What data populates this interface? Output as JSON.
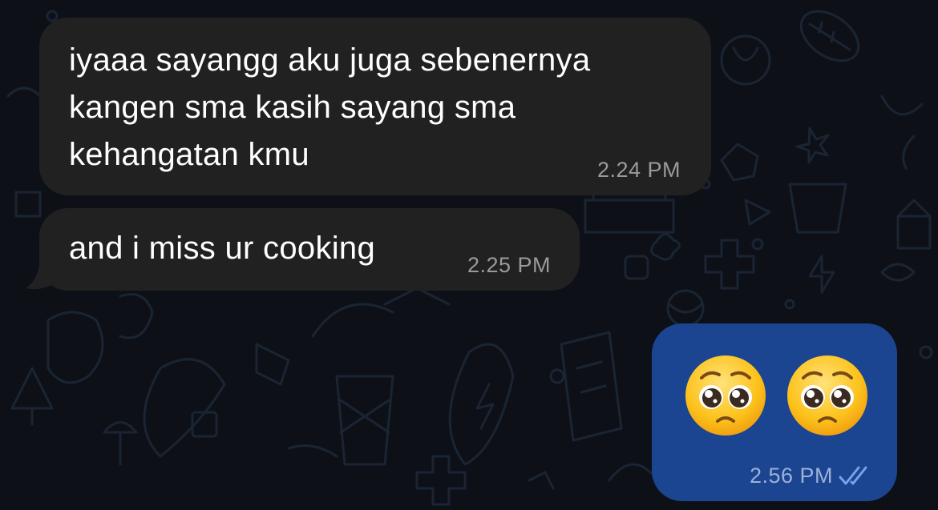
{
  "messages": [
    {
      "direction": "incoming",
      "lines": [
        "iyaaa sayangg aku juga sebenernya",
        "kangen sma kasih sayang sma",
        "kehangatan kmu"
      ],
      "time": "2.24 PM"
    },
    {
      "direction": "incoming",
      "text": "and i miss ur cooking",
      "time": "2.25 PM"
    },
    {
      "direction": "outgoing",
      "emojis": [
        "pleading-face",
        "pleading-face"
      ],
      "time": "2.56 PM",
      "status": "read"
    }
  ],
  "colors": {
    "background": "#0d1117",
    "incoming_bubble": "#212121",
    "outgoing_bubble": "#1c4591",
    "read_check": "#7aa2e6"
  }
}
